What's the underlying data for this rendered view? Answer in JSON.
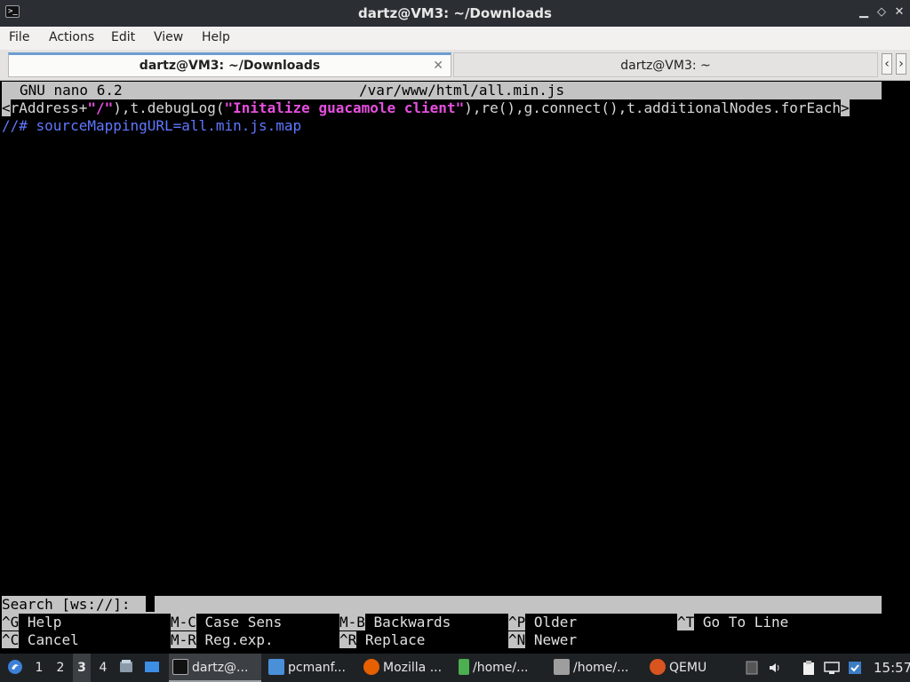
{
  "window": {
    "title": "dartz@VM3: ~/Downloads",
    "app_icon_glyph": ">_",
    "minimize_glyph": "▁",
    "maximize_glyph": "◇",
    "close_glyph": "✕"
  },
  "menubar": {
    "items": [
      "File",
      "Actions",
      "Edit",
      "View",
      "Help"
    ]
  },
  "tabs": [
    {
      "label": "dartz@VM3: ~/Downloads",
      "active": true,
      "close_glyph": "✕"
    },
    {
      "label": "dartz@VM3: ~",
      "active": false
    }
  ],
  "tab_scroll": {
    "left_glyph": "‹",
    "right_glyph": "›"
  },
  "nano": {
    "version": "GNU nano 6.2",
    "filename": "/var/www/html/all.min.js",
    "code_line": {
      "left_marker": "<",
      "part1": "rAddress+",
      "str1": "\"/\"",
      "part2": "),t.debugLog(",
      "str2": "\"Initalize guacamole client\"",
      "part3": "),re(),g.connect(),t.additionalNodes.forEach",
      "right_marker": ">"
    },
    "comment_line": "//# sourceMappingURL=all.min.js.map",
    "search_prompt": "Search [ws://]: ",
    "shortcuts": [
      {
        "key": "^G",
        "label": "Help"
      },
      {
        "key": "M-C",
        "label": "Case Sens"
      },
      {
        "key": "M-B",
        "label": "Backwards"
      },
      {
        "key": "^P",
        "label": "Older"
      },
      {
        "key": "^T",
        "label": "Go To Line"
      },
      {
        "key": "^C",
        "label": "Cancel"
      },
      {
        "key": "M-R",
        "label": "Reg.exp."
      },
      {
        "key": "^R",
        "label": "Replace"
      },
      {
        "key": "^N",
        "label": "Newer"
      }
    ]
  },
  "taskbar": {
    "workspaces": [
      "1",
      "2",
      "3",
      "4"
    ],
    "active_workspace": "3",
    "tasks": [
      {
        "label": "dartz@...",
        "icon": "terminal-icon",
        "color": "#2b2f33",
        "active": true
      },
      {
        "label": "pcmanf...",
        "icon": "folder-icon",
        "color": "#4a90d9",
        "active": false
      },
      {
        "label": "Mozilla ...",
        "icon": "firefox-icon",
        "color": "#e66000",
        "active": false
      },
      {
        "label": "/home/...",
        "icon": "text-file-icon",
        "color": "#4caf50",
        "active": false
      },
      {
        "label": "/home/...",
        "icon": "feather-icon",
        "color": "#9e9e9e",
        "active": false
      },
      {
        "label": "QEMU",
        "icon": "qemu-icon",
        "color": "#d9541e",
        "active": false
      }
    ],
    "clock": "15:57"
  },
  "colors": {
    "nano_bar": "#c3c3c3",
    "string_highlight": "#e64fe0",
    "comment": "#5f78ff",
    "taskbar": "#1f2225",
    "titlebar": "#2b2f33"
  }
}
